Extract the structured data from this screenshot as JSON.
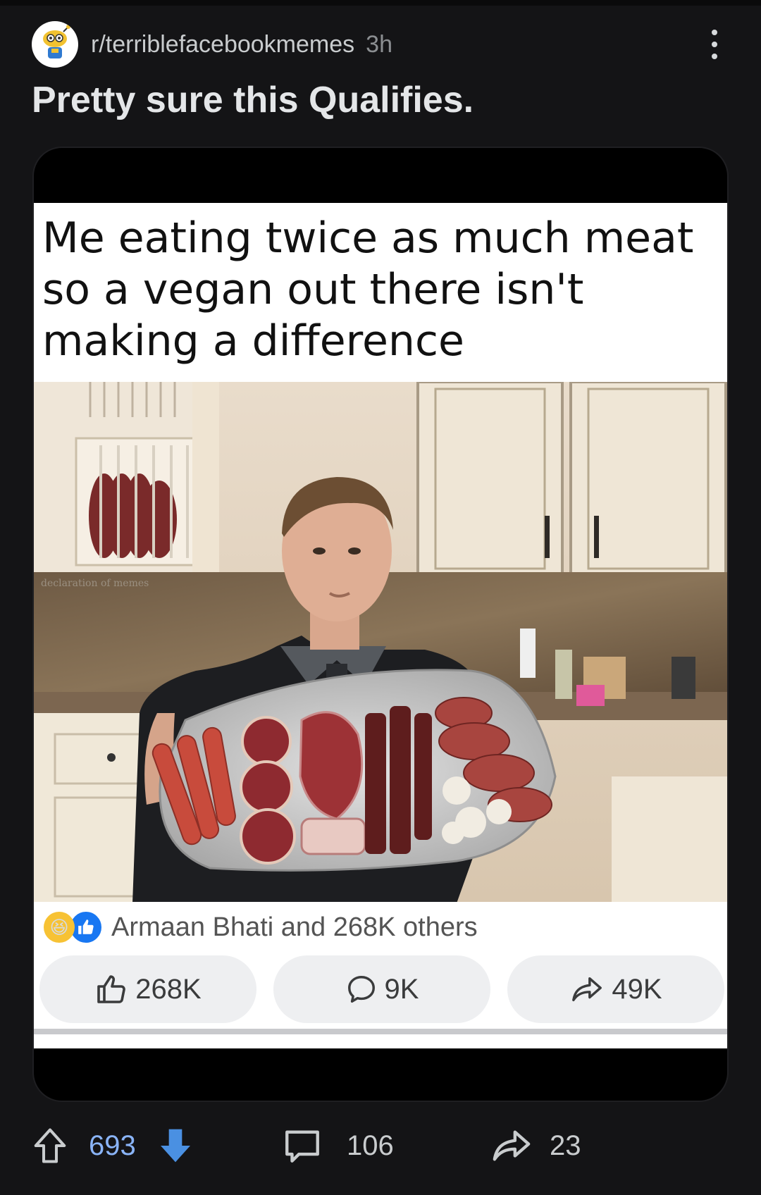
{
  "post": {
    "subreddit": "r/terriblefacebookmemes",
    "time_ago": "3h",
    "title": "Pretty sure this Qualifies."
  },
  "meme": {
    "caption": "Me eating twice as much meat so a vegan out there isn't making a difference",
    "watermark": "declaration of memes",
    "reactions_text": "Armaan Bhati and 268K others",
    "buttons": {
      "like": "268K",
      "comment": "9K",
      "share": "49K"
    }
  },
  "footer": {
    "score": "693",
    "comments": "106",
    "shares": "23"
  },
  "colors": {
    "background": "#141416",
    "upvote_accent": "#8ab4f8",
    "downvote_accent": "#4a90e2",
    "fb_like_blue": "#1877f2"
  },
  "icons": [
    "subreddit-avatar-icon",
    "more-options-icon",
    "haha-reaction-icon",
    "like-reaction-icon",
    "thumbs-up-icon",
    "comment-bubble-icon",
    "share-arrow-icon",
    "upvote-arrow-icon",
    "downvote-arrow-icon",
    "comments-icon",
    "share-icon"
  ]
}
